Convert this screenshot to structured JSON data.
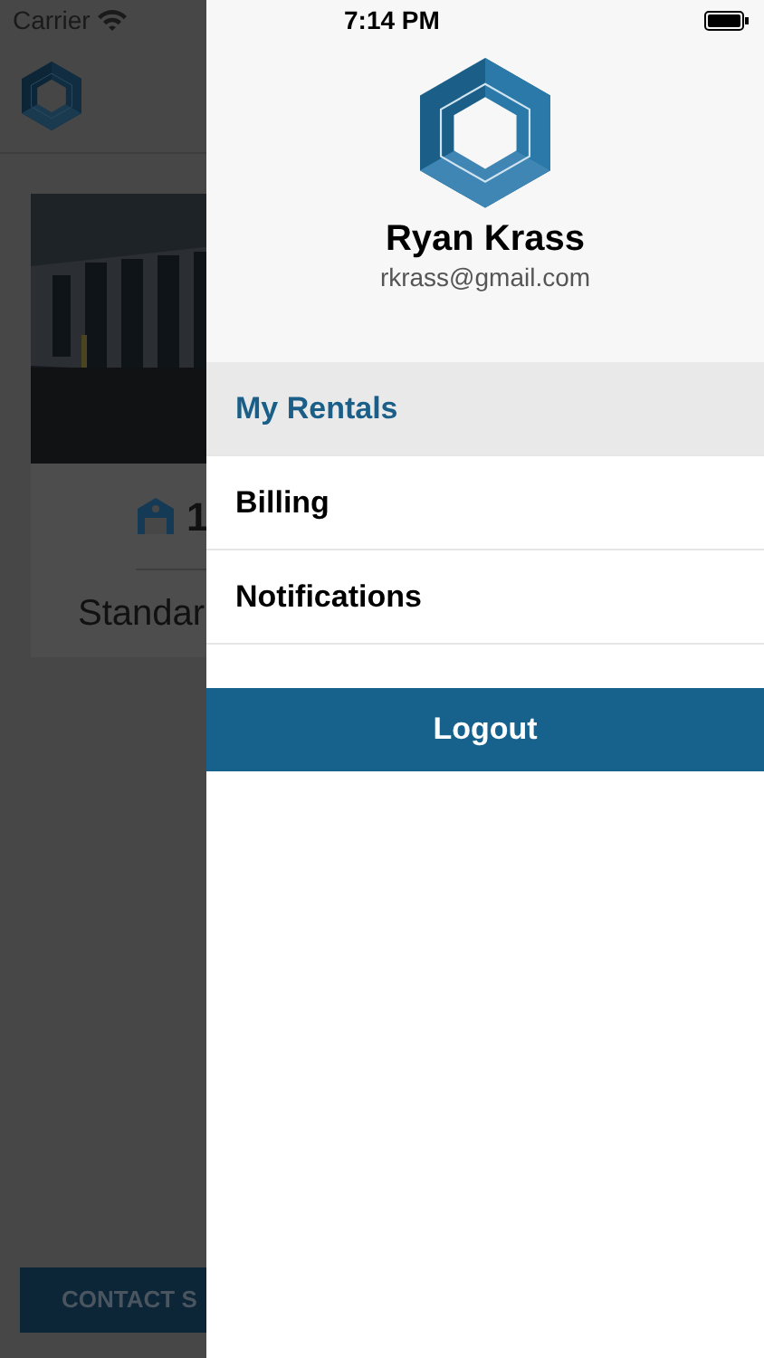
{
  "status_bar": {
    "carrier": "Carrier",
    "time": "7:14 PM"
  },
  "background": {
    "card": {
      "unit_count": "1",
      "unit_type": "Standar"
    },
    "contact_button": "CONTACT S"
  },
  "drawer": {
    "profile": {
      "name": "Ryan Krass",
      "email": "rkrass@gmail.com"
    },
    "menu": [
      {
        "label": "My Rentals",
        "selected": true
      },
      {
        "label": "Billing",
        "selected": false
      },
      {
        "label": "Notifications",
        "selected": false
      }
    ],
    "logout": "Logout"
  }
}
